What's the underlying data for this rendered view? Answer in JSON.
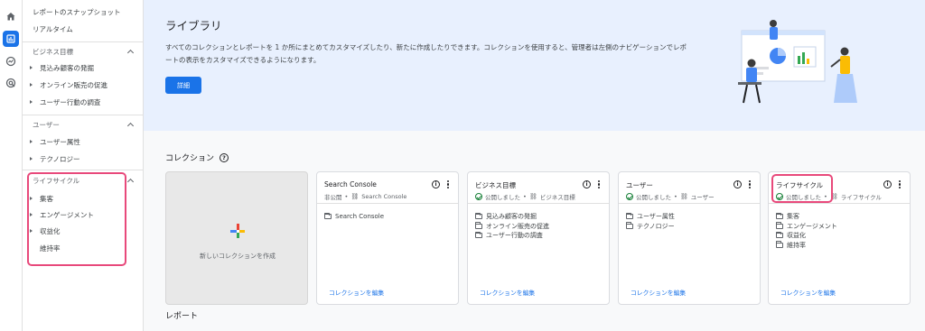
{
  "rail": {
    "icons": [
      "home-icon",
      "reports-icon",
      "explore-icon",
      "advertising-icon"
    ]
  },
  "sidebar": {
    "top_items": [
      {
        "label": "レポートのスナップショット"
      },
      {
        "label": "リアルタイム"
      }
    ],
    "sections": [
      {
        "title": "ビジネス目標",
        "items": [
          "見込み顧客の発掘",
          "オンライン販売の促進",
          "ユーザー行動の調査"
        ]
      },
      {
        "title": "ユーザー",
        "items": [
          "ユーザー属性",
          "テクノロジー"
        ]
      },
      {
        "title": "ライフサイクル",
        "items": [
          "集客",
          "エンゲージメント",
          "収益化",
          "維持率"
        ]
      }
    ]
  },
  "hero": {
    "title": "ライブラリ",
    "description": "すべてのコレクションとレポートを 1 か所にまとめてカスタマイズしたり、新たに作成したりできます。コレクションを使用すると、管理者は左側のナビゲーションでレポートの表示をカスタマイズできるようになります。",
    "button": "詳細"
  },
  "collections": {
    "title": "コレクション",
    "help": "?",
    "new_label": "新しいコレクションを作成",
    "cards": [
      {
        "title": "Search Console",
        "status": "非公開",
        "source": "Search Console",
        "items": [
          "Search Console"
        ],
        "edit": "コレクションを編集",
        "published": false
      },
      {
        "title": "ビジネス目標",
        "status": "公開しました",
        "source": "ビジネス目標",
        "items": [
          "見込み顧客の発掘",
          "オンライン販売の促進",
          "ユーザー行動の調査"
        ],
        "edit": "コレクションを編集",
        "published": true
      },
      {
        "title": "ユーザー",
        "status": "公開しました",
        "source": "ユーザー",
        "items": [
          "ユーザー属性",
          "テクノロジー"
        ],
        "edit": "コレクションを編集",
        "published": true
      },
      {
        "title": "ライフサイクル",
        "status": "公開しました",
        "source": "ライフサイクル",
        "items": [
          "集客",
          "エンゲージメント",
          "収益化",
          "維持率"
        ],
        "edit": "コレクションを編集",
        "published": true
      }
    ]
  },
  "reports": {
    "title": "レポート"
  },
  "colors": {
    "accent": "#1a73e8",
    "highlight": "#e8497b",
    "published": "#188038"
  }
}
